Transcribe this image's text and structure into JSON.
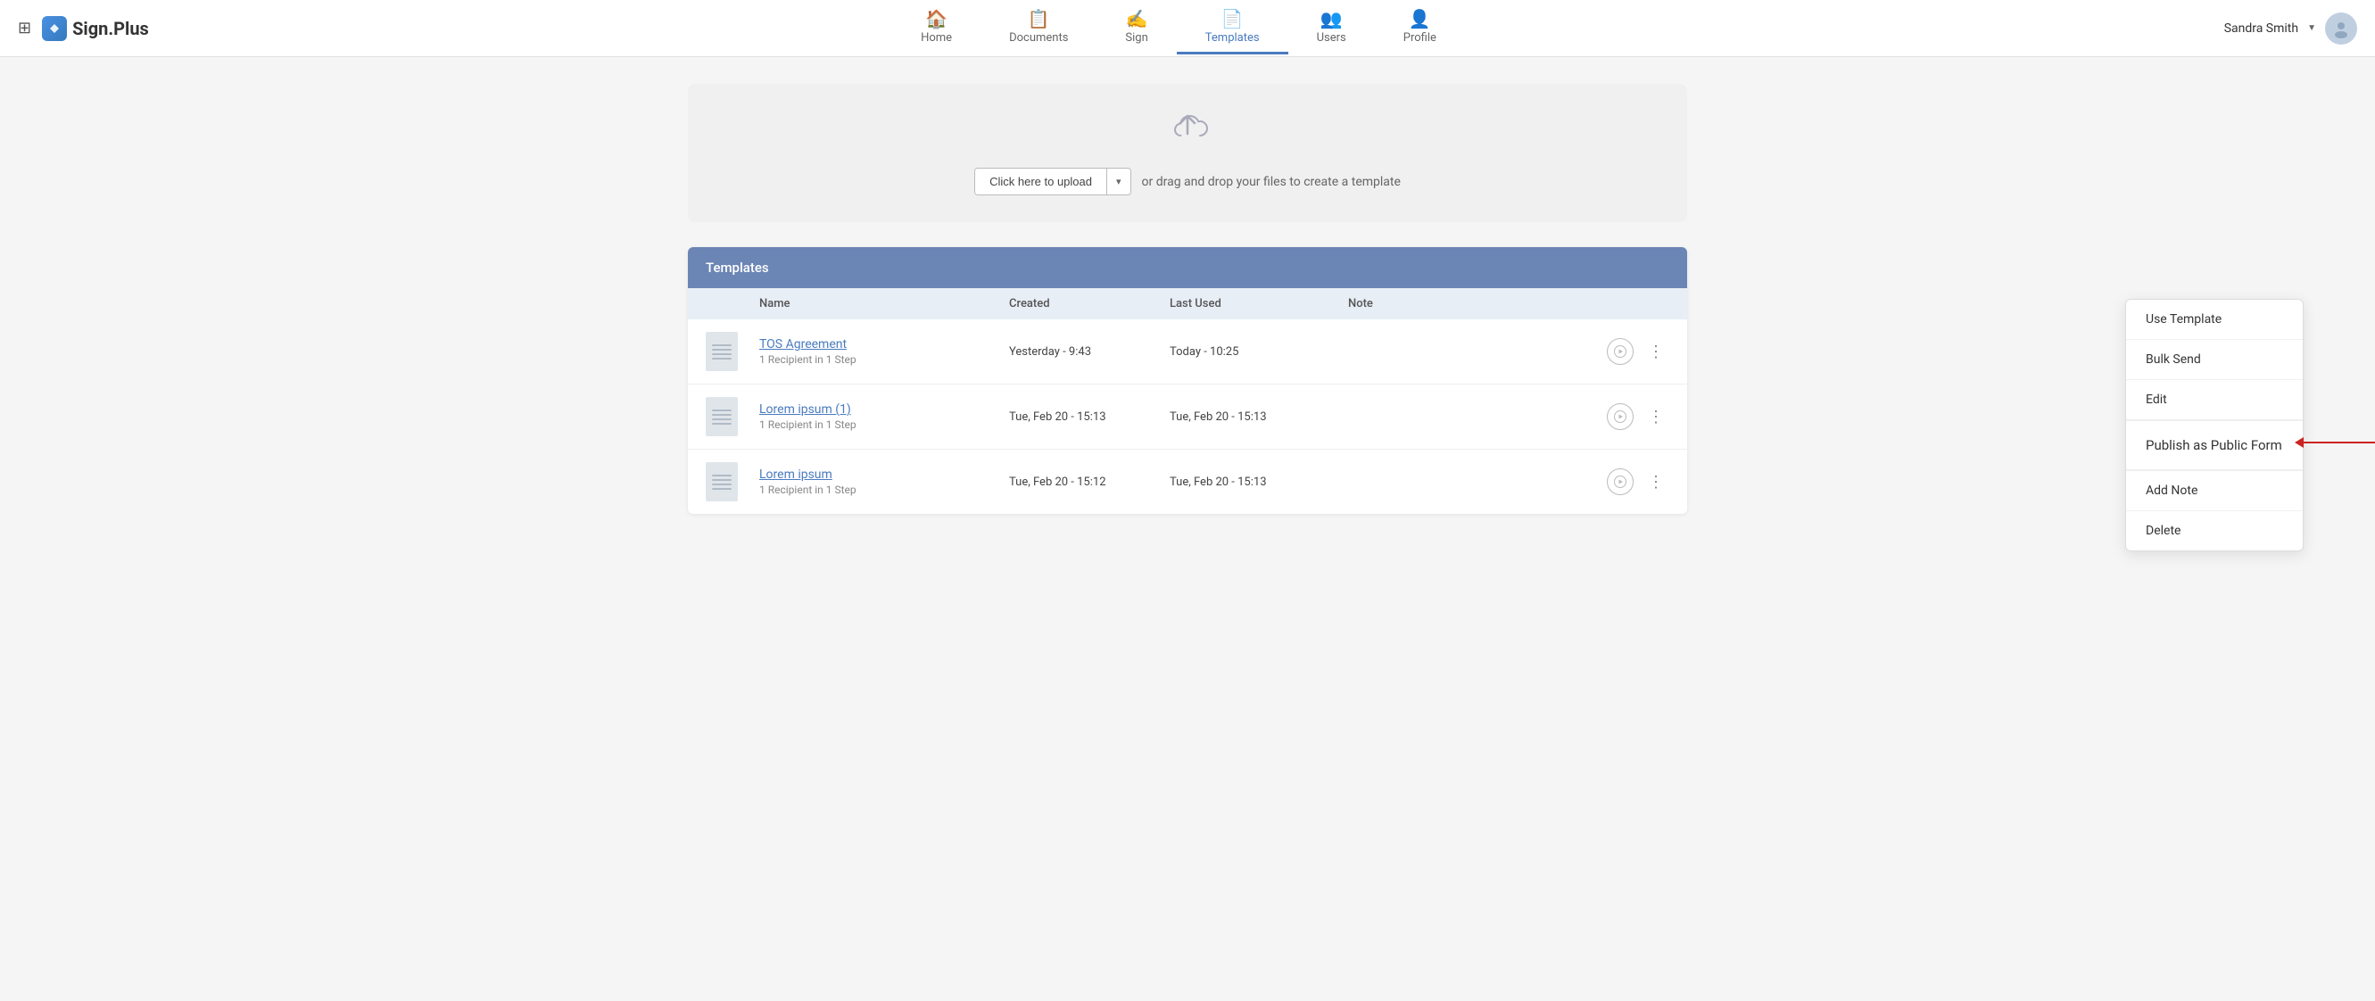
{
  "app": {
    "name": "Sign.Plus"
  },
  "nav": {
    "items": [
      {
        "id": "home",
        "label": "Home",
        "icon": "🏠",
        "active": false
      },
      {
        "id": "documents",
        "label": "Documents",
        "icon": "📋",
        "active": false
      },
      {
        "id": "sign",
        "label": "Sign",
        "icon": "✍",
        "active": false
      },
      {
        "id": "templates",
        "label": "Templates",
        "icon": "📄",
        "active": true
      },
      {
        "id": "users",
        "label": "Users",
        "icon": "👥",
        "active": false
      },
      {
        "id": "profile",
        "label": "Profile",
        "icon": "👤",
        "active": false
      }
    ]
  },
  "user": {
    "name": "Sandra Smith",
    "dropdown_arrow": "▼"
  },
  "upload": {
    "icon": "⬆",
    "button_label": "Click here to upload",
    "hint": "or drag and drop your files to create a template"
  },
  "table": {
    "title": "Templates",
    "columns": {
      "name": "Name",
      "created": "Created",
      "last_used": "Last Used",
      "note": "Note"
    },
    "rows": [
      {
        "id": 1,
        "name": "TOS Agreement",
        "subtitle": "1 Recipient in 1 Step",
        "created": "Yesterday - 9:43",
        "last_used": "Today - 10:25",
        "note": ""
      },
      {
        "id": 2,
        "name": "Lorem ipsum (1)",
        "subtitle": "1 Recipient in 1 Step",
        "created": "Tue, Feb 20 - 15:13",
        "last_used": "Tue, Feb 20 - 15:13",
        "note": ""
      },
      {
        "id": 3,
        "name": "Lorem ipsum",
        "subtitle": "1 Recipient in 1 Step",
        "created": "Tue, Feb 20 - 15:12",
        "last_used": "Tue, Feb 20 - 15:13",
        "note": ""
      }
    ]
  },
  "context_menu": {
    "items": [
      {
        "id": "use-template",
        "label": "Use Template"
      },
      {
        "id": "bulk-send",
        "label": "Bulk Send"
      },
      {
        "id": "edit",
        "label": "Edit"
      },
      {
        "id": "publish",
        "label": "Publish as Public Form"
      },
      {
        "id": "add-note",
        "label": "Add Note"
      },
      {
        "id": "delete",
        "label": "Delete"
      }
    ]
  }
}
